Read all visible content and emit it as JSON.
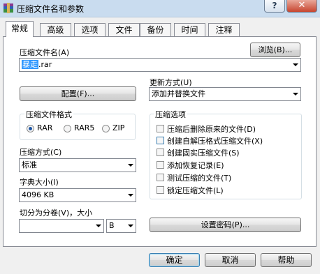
{
  "window": {
    "title": "压缩文件名和参数",
    "help_label": "?",
    "close_label": "✕"
  },
  "tabs": [
    {
      "label": "常规",
      "active": true
    },
    {
      "label": "高级"
    },
    {
      "label": "选项"
    },
    {
      "label": "文件"
    },
    {
      "label": "备份"
    },
    {
      "label": "时间"
    },
    {
      "label": "注释"
    }
  ],
  "archive_name": {
    "label": "压缩文件名(A)",
    "browse_label": "浏览(B)...",
    "value_selected": "暴走",
    "value_rest": ".rar"
  },
  "update_mode": {
    "label": "更新方式(U)",
    "value": "添加并替换文件"
  },
  "profiles_button": "配置(F)...",
  "format": {
    "title": "压缩文件格式",
    "options": [
      "RAR",
      "RAR5",
      "ZIP"
    ],
    "selected": "RAR"
  },
  "compression_method": {
    "label": "压缩方式(C)",
    "value": "标准"
  },
  "dictionary_size": {
    "label": "字典大小(I)",
    "value": "4096 KB"
  },
  "split": {
    "label": "切分为分卷(V)，大小",
    "value": "",
    "unit": "B"
  },
  "options": {
    "title": "压缩选项",
    "items": [
      {
        "label": "压缩后删除原来的文件(D)",
        "checked": false
      },
      {
        "label": "创建自解压格式压缩文件(X)",
        "checked": false
      },
      {
        "label": "创建固实压缩文件(S)",
        "checked": false
      },
      {
        "label": "添加恢复记录(E)",
        "checked": false
      },
      {
        "label": "测试压缩的文件(T)",
        "checked": false
      },
      {
        "label": "锁定压缩文件(L)",
        "checked": false
      }
    ]
  },
  "password_button": "设置密码(P)...",
  "footer": {
    "ok": "确定",
    "cancel": "取消",
    "help": "帮助"
  }
}
